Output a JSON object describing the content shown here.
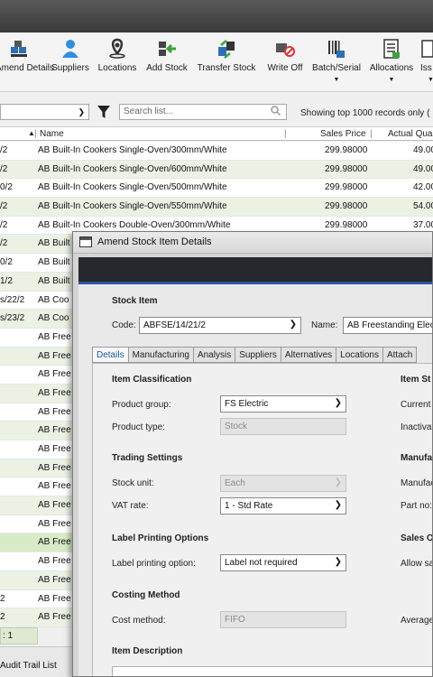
{
  "ribbon": [
    {
      "label": "Amend Details",
      "icon": "amend-details-icon"
    },
    {
      "label": "Suppliers",
      "icon": "suppliers-icon"
    },
    {
      "label": "Locations",
      "icon": "locations-icon"
    },
    {
      "label": "Add Stock",
      "icon": "add-stock-icon"
    },
    {
      "label": "Transfer Stock",
      "icon": "transfer-stock-icon"
    },
    {
      "label": "Write Off",
      "icon": "write-off-icon"
    },
    {
      "label": "Batch/Serial",
      "icon": "batch-serial-icon"
    },
    {
      "label": "Allocations",
      "icon": "allocations-icon"
    },
    {
      "label": "Iss",
      "icon": "issue-icon"
    }
  ],
  "filter": {
    "search_placeholder": "Search list...",
    "showing": "Showing top 1000 records only ("
  },
  "columns": {
    "name": "Name",
    "sales_price": "Sales Price",
    "actual_qty": "Actual Qua"
  },
  "rows": [
    {
      "code": "/2",
      "name": "AB Built-In Cookers Single-Oven/300mm/White",
      "price": "299.98000",
      "qty": "49.00"
    },
    {
      "code": "/2",
      "name": "AB Built-In Cookers Single-Oven/600mm/White",
      "price": "299.98000",
      "qty": "49.00"
    },
    {
      "code": "0/2",
      "name": "AB Built-In Cookers Single-Oven/500mm/White",
      "price": "299.98000",
      "qty": "42.00"
    },
    {
      "code": "/2",
      "name": "AB Built-In Cookers Single-Oven/550mm/White",
      "price": "299.98000",
      "qty": "54.00"
    },
    {
      "code": "/2",
      "name": "AB Built-In Cookers Double-Oven/300mm/White",
      "price": "299.98000",
      "qty": "37.00"
    },
    {
      "code": "/2",
      "name": "AB Built",
      "price": "",
      "qty": ""
    },
    {
      "code": "0/2",
      "name": "AB Built",
      "price": "",
      "qty": ""
    },
    {
      "code": "1/2",
      "name": "AB Built",
      "price": "",
      "qty": ""
    },
    {
      "code": "s/22/2",
      "name": "AB Coo",
      "price": "",
      "qty": ""
    },
    {
      "code": "s/23/2",
      "name": "AB Coo",
      "price": "",
      "qty": ""
    },
    {
      "code": "",
      "name": "AB Free",
      "price": "",
      "qty": ""
    },
    {
      "code": "",
      "name": "AB Free",
      "price": "",
      "qty": ""
    },
    {
      "code": "",
      "name": "AB Free",
      "price": "",
      "qty": ""
    },
    {
      "code": "",
      "name": "AB Free",
      "price": "",
      "qty": ""
    },
    {
      "code": "",
      "name": "AB Free",
      "price": "",
      "qty": ""
    },
    {
      "code": "",
      "name": "AB Free",
      "price": "",
      "qty": ""
    },
    {
      "code": "",
      "name": "AB Free",
      "price": "",
      "qty": ""
    },
    {
      "code": "",
      "name": "AB Free",
      "price": "",
      "qty": ""
    },
    {
      "code": "",
      "name": "AB Free",
      "price": "",
      "qty": ""
    },
    {
      "code": "",
      "name": "AB Free",
      "price": "",
      "qty": ""
    },
    {
      "code": "",
      "name": "AB Free",
      "price": "",
      "qty": ""
    },
    {
      "code": "",
      "name": "AB Free",
      "price": "",
      "qty": ""
    },
    {
      "code": "",
      "name": "AB Free",
      "price": "",
      "qty": ""
    },
    {
      "code": "",
      "name": "AB Free",
      "price": "",
      "qty": ""
    },
    {
      "code": "2",
      "name": "AB Free",
      "price": "",
      "qty": ""
    },
    {
      "code": "2",
      "name": "AB Free",
      "price": "",
      "qty": ""
    }
  ],
  "record_count": ": 1",
  "audit_trail": "Audit Trail List",
  "dialog": {
    "title": "Amend Stock Item Details",
    "stock_item": "Stock Item",
    "code_label": "Code:",
    "code_value": "ABFSE/14/21/2",
    "name_label": "Name:",
    "name_value": "AB Freestanding Elec",
    "tabs": [
      "Details",
      "Manufacturing",
      "Analysis",
      "Suppliers",
      "Alternatives",
      "Locations",
      "Attach"
    ],
    "item_classification": "Item Classification",
    "product_group_label": "Product group:",
    "product_group_value": "FS Electric",
    "product_type_label": "Product type:",
    "product_type_value": "Stock",
    "trading_settings": "Trading Settings",
    "stock_unit_label": "Stock unit:",
    "stock_unit_value": "Each",
    "vat_rate_label": "VAT rate:",
    "vat_rate_value": "1 - Std Rate",
    "label_printing": "Label Printing Options",
    "label_option_label": "Label printing option:",
    "label_option_value": "Label not required",
    "costing": "Costing Method",
    "cost_method_label": "Cost method:",
    "cost_method_value": "FIFO",
    "item_description": "Item Description",
    "right_status": "Item St",
    "right_current": "Current",
    "right_inactive": "Inactivat",
    "right_manuf": "Manufa",
    "right_manufac": "Manufac",
    "right_partno": "Part no:",
    "right_sales": "Sales O",
    "right_allow": "Allow sa",
    "right_average": "Average"
  },
  "colors": {
    "accent": "#2a56a5",
    "row_alt": "#ebf2e4",
    "row_selected": "#d8ebc6"
  }
}
